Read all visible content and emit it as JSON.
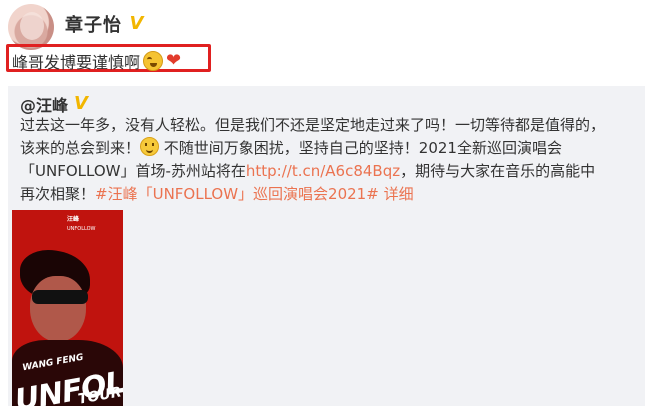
{
  "post": {
    "username": "章子怡",
    "verified_badge": "V",
    "text": "峰哥发博要谨慎啊"
  },
  "repost": {
    "username": "@汪峰",
    "verified_badge": "V",
    "line1": "过去这一年多，没有人轻松。但是我们不还是坚定地走过来了吗！一切等待都是值得的，",
    "line2a": "该来的总会到来！",
    "line2b": " 不随世间万象困扰，坚持自己的坚持！2021全新巡回演唱会",
    "line3a": "「UNFOLLOW」首场-苏州站将在",
    "line3link": "http://t.cn/A6c84Bqz",
    "line3b": "，期待与大家在音乐的高能中",
    "line4a": "再次相聚！",
    "hashtag": "#汪峰「UNFOLLOW」巡回演唱会2021#",
    "detail_link": "详细"
  },
  "poster": {
    "title": "汪峰",
    "subtitle": "UNFOLLOW",
    "artist_en": "WANG FENG",
    "word1": "UNFOLLOW",
    "word2": "TOUR"
  },
  "colors": {
    "highlight_border": "#e02020",
    "link": "#eb7350",
    "badge": "#f2b600",
    "repost_bg": "#f1f2f5"
  },
  "icons": [
    "avatar",
    "verified-badge-icon",
    "laughing-crying-emoji-icon",
    "heart-icon",
    "smile-emoji-icon"
  ]
}
